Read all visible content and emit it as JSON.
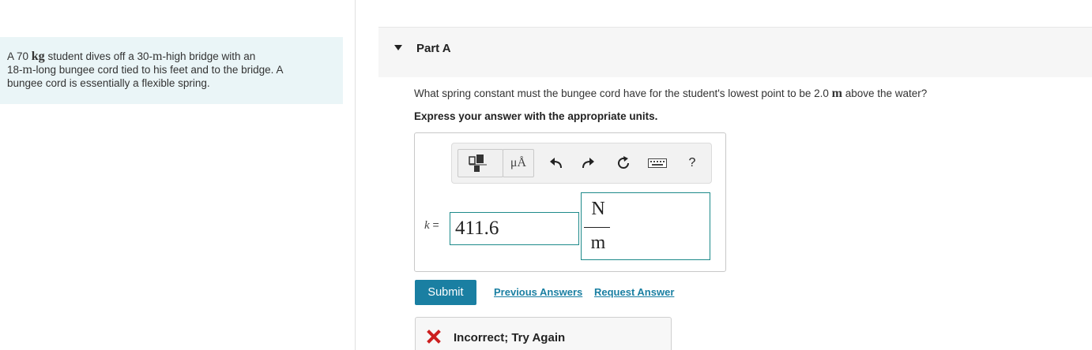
{
  "problem": {
    "text_a": "A 70 ",
    "unit_kg": "kg",
    "text_b": " student dives off a 30-",
    "unit_m1": "m",
    "text_c": "-high bridge with an",
    "text_d": "18-",
    "unit_m2": "m",
    "text_e": "-long bungee cord tied to his feet and to the bridge. A",
    "text_f": "bungee cord is essentially a flexible spring."
  },
  "part": {
    "title": "Part A"
  },
  "question": {
    "text_a": "What spring constant must the bungee cord have for the student's lowest point to be 2.0 ",
    "unit_m": "m",
    "text_b": " above the water?",
    "instructions": "Express your answer with the appropriate units."
  },
  "toolbar": {
    "units_button_label": "μÅ",
    "help_label": "?",
    "icons": [
      "templates-icon",
      "units-icon",
      "undo-icon",
      "redo-icon",
      "reset-icon",
      "keyboard-icon",
      "help-icon"
    ]
  },
  "answer": {
    "variable": "k",
    "equals": " =",
    "value": "411.6",
    "unit_numerator": "N",
    "unit_denominator": "m"
  },
  "actions": {
    "submit_label": "Submit",
    "previous_answers_label": "Previous Answers",
    "request_answer_label": "Request Answer"
  },
  "feedback": {
    "text": "Incorrect; Try Again",
    "status_color": "#cc1f1f"
  },
  "colors": {
    "accent": "#1a7fa2",
    "input_border": "#1d8a8a",
    "problem_bg": "#eaf5f7"
  }
}
